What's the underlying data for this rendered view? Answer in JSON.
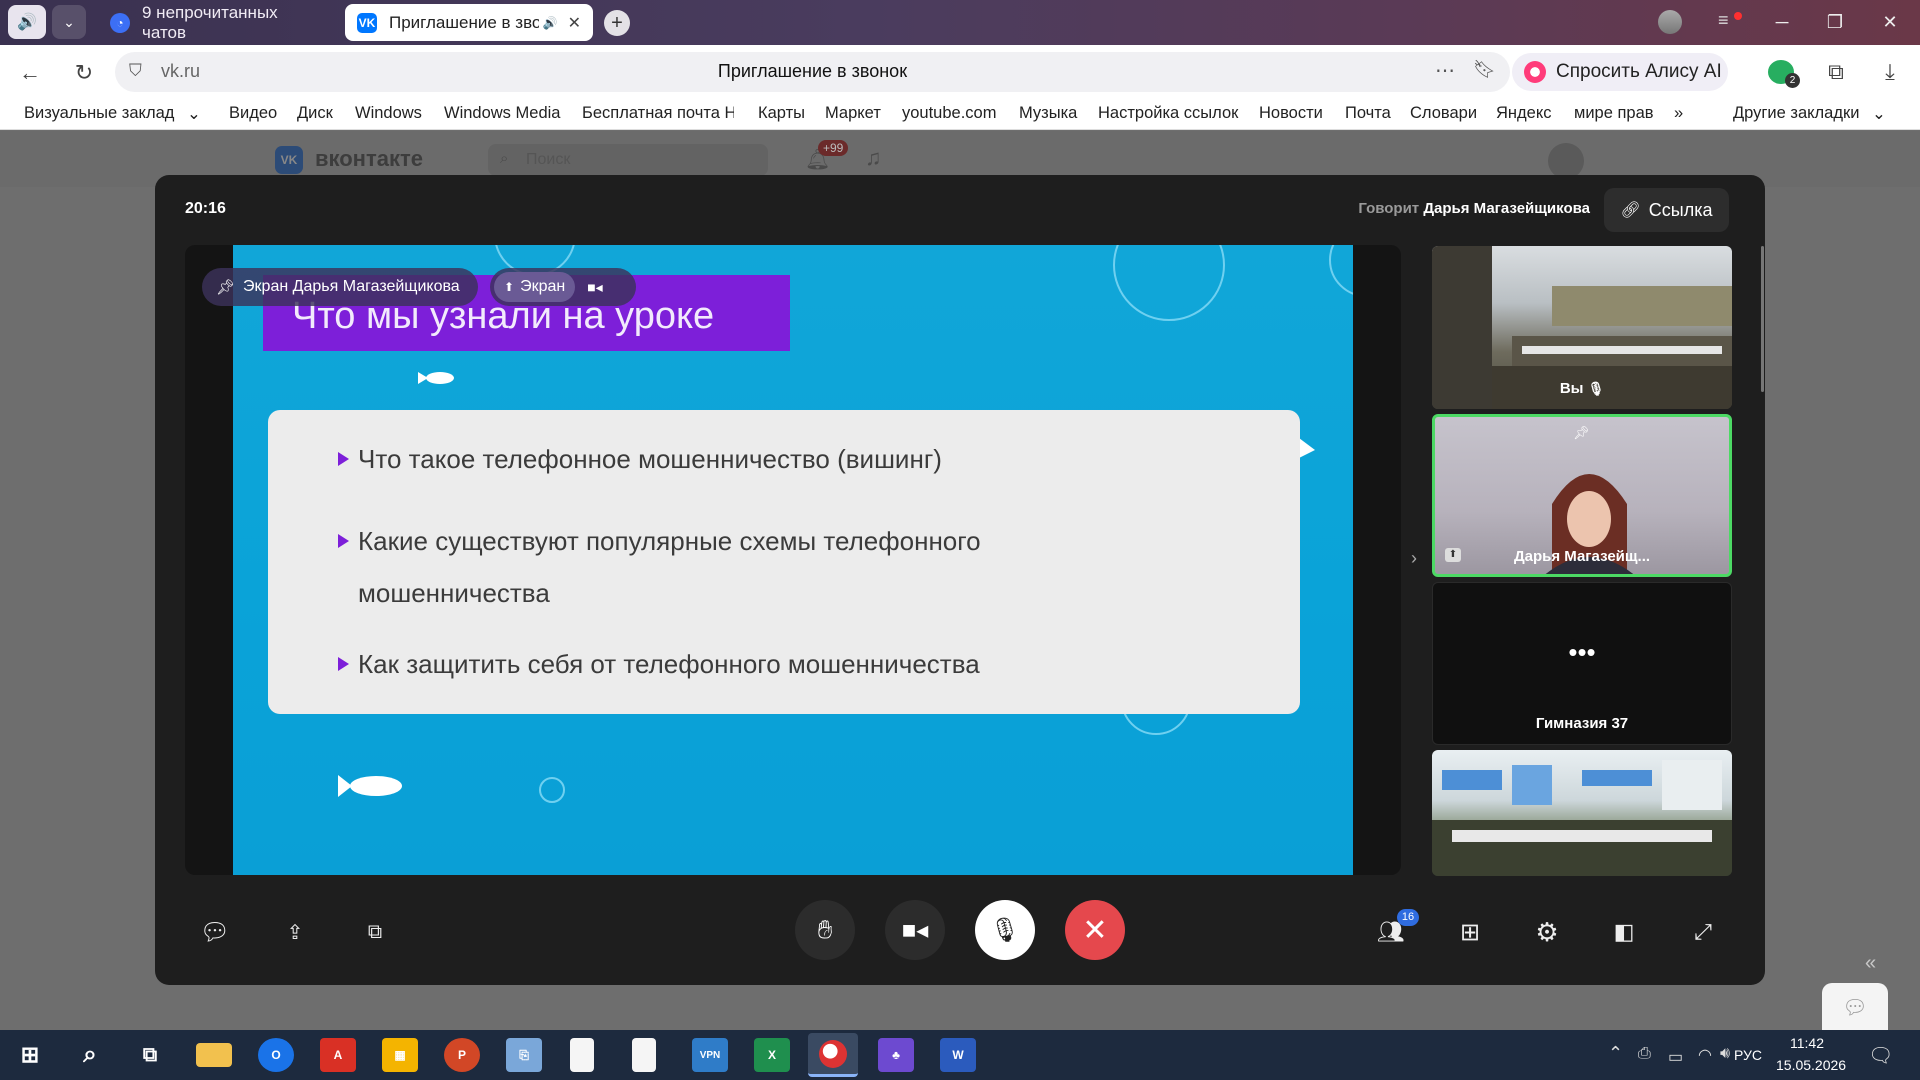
{
  "browser": {
    "tabs": [
      {
        "label": "9 непрочитанных чатов",
        "active": false
      },
      {
        "label": "Приглашение в звон",
        "active": true
      }
    ],
    "address": {
      "url": "vk.ru",
      "page_title": "Приглашение в звонок"
    },
    "alice_button": "Спросить Алису AI",
    "extension_badge": "2",
    "bookmarks": [
      "Визуальные заклад",
      "Видео",
      "Диск",
      "Windows",
      "Windows Media",
      "Бесплатная почта Н",
      "Карты",
      "Маркет",
      "youtube.com",
      "Музыка",
      "Настройка ссылок",
      "Новости",
      "Почта",
      "Словари",
      "Яндекс",
      "мире прав"
    ],
    "bookmarks_more": "»",
    "other_bookmarks": "Другие закладки"
  },
  "vk": {
    "logo_text": "вконтакте",
    "search_placeholder": "Поиск",
    "notification_badge": "+99"
  },
  "call": {
    "timer": "20:16",
    "speaking_prefix": "Говорит",
    "speaking_name": "Дарья Магазейщикова",
    "link_button": "Ссылка",
    "screen_label": "Экран Дарья Магазейщикова",
    "screen_tab": "Экран",
    "participants_count": "16",
    "slide": {
      "title": "Что мы узнали на уроке",
      "bullets": [
        "Что такое телефонное мошенничество (вишинг)",
        "Какие существуют популярные схемы телефонного",
        "мошенничества",
        "Как защитить себя от телефонного мошенничества"
      ]
    },
    "participants": [
      {
        "label": "Вы"
      },
      {
        "label": "Дарья Магазейщ..."
      },
      {
        "label": "Гимназия 37"
      },
      {
        "label": ""
      }
    ]
  },
  "taskbar": {
    "language": "РУС",
    "time": "11:42",
    "date": "15.05.2026"
  },
  "colors": {
    "slide_bg": "#0aa3d8",
    "slide_title_bg": "#7d1fd9",
    "hangup": "#e5484d",
    "active_tile_border": "#4cd964"
  }
}
